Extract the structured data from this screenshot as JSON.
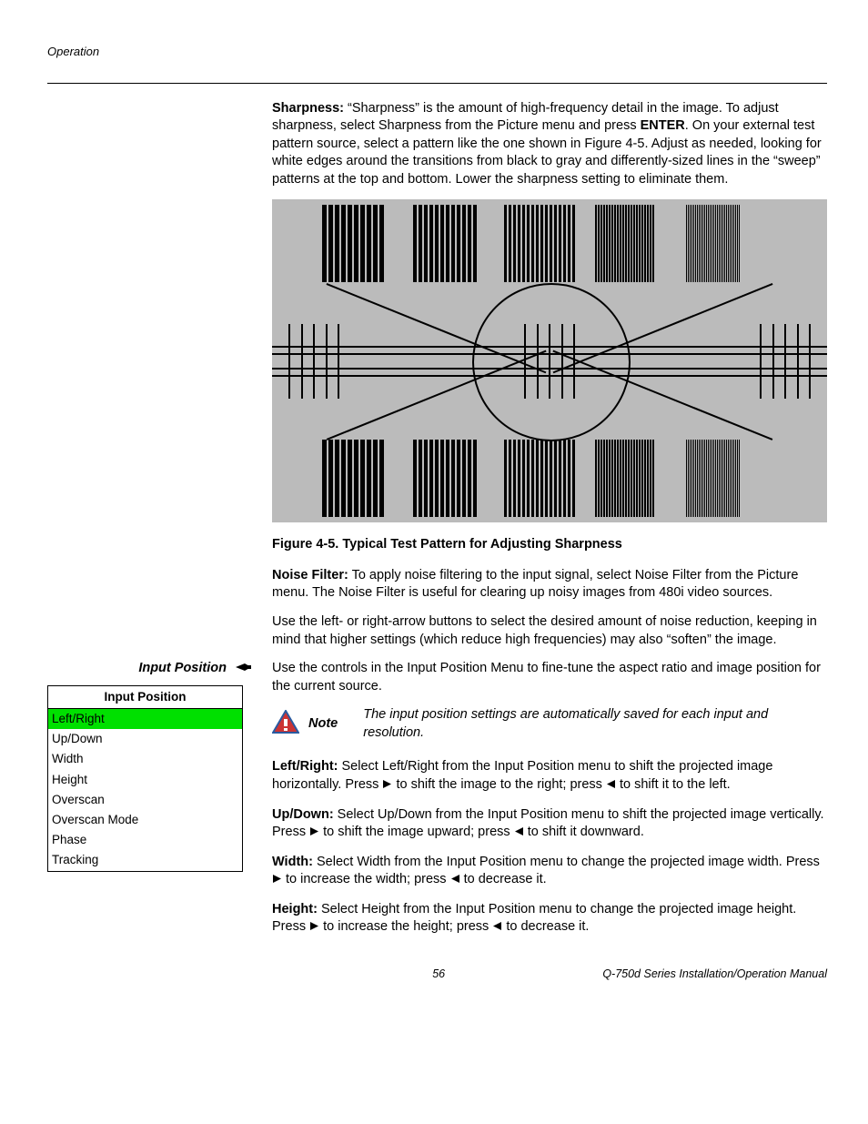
{
  "header": "Operation",
  "sharpness": {
    "label": "Sharpness:",
    "text1": " “Sharpness” is the amount of high-frequency detail in the image. To adjust sharpness, select Sharpness from the Picture menu and press ",
    "enter": "ENTER",
    "text2": ". On your external test pattern source, select a pattern like the one shown in Figure 4-5. Adjust as needed, looking for white edges around the transitions from black to gray and differently-sized lines in the “sweep” patterns at the top and bottom. Lower the sharpness setting to eliminate them."
  },
  "figure_caption": "Figure 4-5. Typical Test Pattern for Adjusting Sharpness",
  "noise": {
    "label": "Noise Filter:",
    "text1": " To apply noise filtering to the input signal, select Noise Filter from the Picture menu. The Noise Filter is useful for clearing up noisy images from 480i video sources.",
    "text2": "Use the left- or right-arrow buttons to select the desired amount of noise reduction, keeping in mind that higher settings (which reduce high frequencies) may also “soften” the image."
  },
  "input_position": {
    "heading": "Input Position",
    "intro": "Use the controls in the Input Position Menu to fine-tune the aspect ratio and image position for the current source.",
    "menu_title": "Input Position",
    "menu_items": [
      "Left/Right",
      "Up/Down",
      "Width",
      "Height",
      "Overscan",
      "Overscan Mode",
      "Phase",
      "Tracking"
    ],
    "note_label": "Note",
    "note_text": "The input position settings are automatically saved for each input and resolution.",
    "leftright": {
      "label": "Left/Right:",
      "a": " Select Left/Right from the Input Position menu to shift the projected image horizontally. Press ",
      "b": " to shift the image to the right; press ",
      "c": " to shift it to the left."
    },
    "updown": {
      "label": "Up/Down:",
      "a": " Select Up/Down from the Input Position menu to shift the projected image vertically. Press ",
      "b": " to shift the image upward; press ",
      "c": " to shift it downward."
    },
    "width": {
      "label": "Width:",
      "a": " Select Width from the Input Position menu to change the projected image width. Press ",
      "b": " to increase the width; press ",
      "c": " to decrease it."
    },
    "height": {
      "label": "Height:",
      "a": " Select Height from the Input Position menu to change the projected image height. Press ",
      "b": " to increase the height; press ",
      "c": " to decrease it."
    }
  },
  "footer": {
    "page": "56",
    "manual": "Q-750d Series Installation/Operation Manual"
  }
}
